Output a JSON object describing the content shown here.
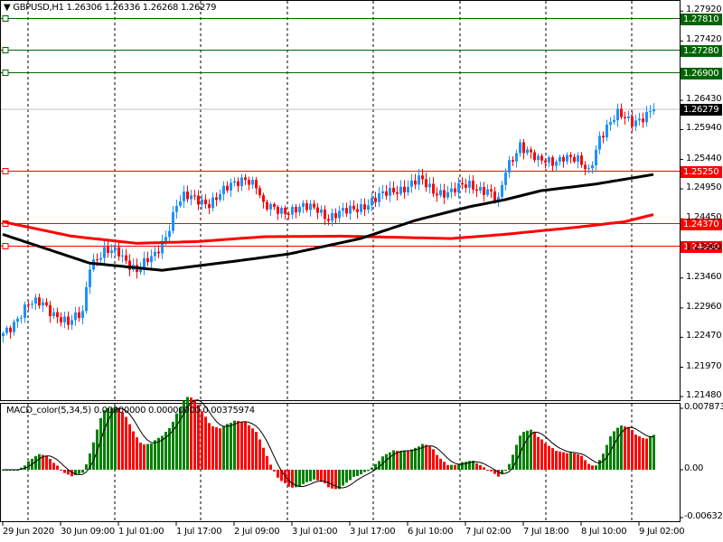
{
  "header": {
    "symbol": "GBPUSD,H1",
    "ohlc": "1.26306 1.26336 1.26268 1.26279",
    "menu_icon": "triangle-down-icon"
  },
  "indicator": {
    "label": "MACD_color(5,34,5) 0.00000000 0.00000000 0.00375974",
    "max": "0.0078738",
    "zero": "0.00",
    "min": "-0.006323"
  },
  "colors": {
    "up": "#1e90ff",
    "down": "#ff0000",
    "support": "#ff0000",
    "resistance": "#006400",
    "ma_fast": "#000000",
    "ma_slow": "#ff0000",
    "macd_up": "#008000",
    "macd_down": "#ff0000"
  },
  "chart_data": {
    "type": "candlestick",
    "price_axis": [
      "1.27920",
      "1.27420",
      "1.26430",
      "1.25940",
      "1.25440",
      "1.24950",
      "1.24450",
      "1.23960",
      "1.23460",
      "1.22960",
      "1.22470",
      "1.21970",
      "1.21480"
    ],
    "ylim": [
      1.2148,
      1.2795
    ],
    "current_price": "1.26279",
    "levels": [
      {
        "price": 1.2781,
        "label": "1.27810",
        "kind": "resistance"
      },
      {
        "price": 1.2728,
        "label": "1.27280",
        "kind": "resistance"
      },
      {
        "price": 1.269,
        "label": "1.26900",
        "kind": "resistance"
      },
      {
        "price": 1.2525,
        "label": "1.25250",
        "kind": "support"
      },
      {
        "price": 1.2437,
        "label": "1.24370",
        "kind": "support"
      },
      {
        "price": 1.24,
        "label": "1.24000",
        "kind": "support"
      }
    ],
    "time_labels": [
      "29 Jun 2020",
      "30 Jun 09:00",
      "1 Jul 01:00",
      "1 Jul 17:00",
      "2 Jul 09:00",
      "3 Jul 01:00",
      "3 Jul 17:00",
      "6 Jul 10:00",
      "7 Jul 02:00",
      "7 Jul 18:00",
      "8 Jul 10:00",
      "9 Jul 02:00"
    ],
    "bars": 181,
    "close_waypoints": [
      [
        0,
        1.2254
      ],
      [
        7,
        1.23
      ],
      [
        11,
        1.2305
      ],
      [
        18,
        1.2267
      ],
      [
        22,
        1.229
      ],
      [
        24,
        1.2372
      ],
      [
        28,
        1.2388
      ],
      [
        32,
        1.2388
      ],
      [
        37,
        1.236
      ],
      [
        42,
        1.2382
      ],
      [
        45,
        1.2418
      ],
      [
        48,
        1.2471
      ],
      [
        50,
        1.248
      ],
      [
        57,
        1.2473
      ],
      [
        62,
        1.2494
      ],
      [
        67,
        1.2516
      ],
      [
        70,
        1.2501
      ],
      [
        72,
        1.2463
      ],
      [
        79,
        1.246
      ],
      [
        87,
        1.2463
      ],
      [
        90,
        1.2448
      ],
      [
        95,
        1.2456
      ],
      [
        102,
        1.2475
      ],
      [
        109,
        1.2494
      ],
      [
        115,
        1.2509
      ],
      [
        119,
        1.2491
      ],
      [
        124,
        1.2491
      ],
      [
        129,
        1.2501
      ],
      [
        134,
        1.2494
      ],
      [
        137,
        1.2471
      ],
      [
        139,
        1.2524
      ],
      [
        143,
        1.2572
      ],
      [
        148,
        1.2539
      ],
      [
        152,
        1.2542
      ],
      [
        155,
        1.2551
      ],
      [
        159,
        1.2539
      ],
      [
        162,
        1.2524
      ],
      [
        165,
        1.2584
      ],
      [
        170,
        1.2617
      ],
      [
        174,
        1.261
      ],
      [
        178,
        1.2617
      ],
      [
        180,
        1.26279
      ]
    ],
    "ma_fast_waypoints": [
      [
        0,
        1.2419
      ],
      [
        24,
        1.2371
      ],
      [
        44,
        1.2359
      ],
      [
        64,
        1.2374
      ],
      [
        79,
        1.2386
      ],
      [
        99,
        1.2412
      ],
      [
        114,
        1.2442
      ],
      [
        129,
        1.2465
      ],
      [
        139,
        1.2477
      ],
      [
        149,
        1.2492
      ],
      [
        164,
        1.2503
      ],
      [
        180,
        1.2519
      ]
    ],
    "ma_slow_waypoints": [
      [
        0,
        1.244
      ],
      [
        19,
        1.2416
      ],
      [
        37,
        1.2404
      ],
      [
        54,
        1.2407
      ],
      [
        72,
        1.2415
      ],
      [
        94,
        1.2416
      ],
      [
        124,
        1.2412
      ],
      [
        139,
        1.2419
      ],
      [
        159,
        1.2431
      ],
      [
        172,
        1.244
      ],
      [
        180,
        1.2452
      ]
    ]
  }
}
